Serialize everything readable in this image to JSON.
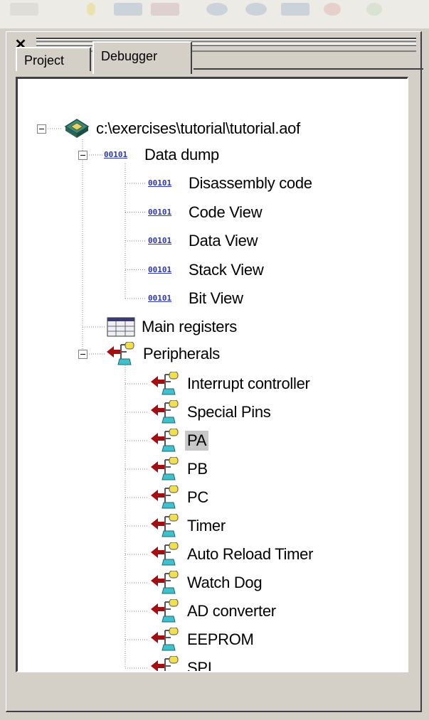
{
  "tabs": [
    {
      "label": "Project"
    },
    {
      "label": "Debugger"
    }
  ],
  "tree": {
    "root": {
      "label": "c:\\exercises\\tutorial\\tutorial.aof",
      "icon": "chip-icon"
    },
    "data_dump": {
      "label": "Data dump",
      "icon_text": "00101",
      "children": [
        {
          "label": "Disassembly code"
        },
        {
          "label": "Code View"
        },
        {
          "label": "Data View"
        },
        {
          "label": "Stack View"
        },
        {
          "label": "Bit View"
        }
      ]
    },
    "main_registers": {
      "label": "Main registers",
      "icon": "registers-icon"
    },
    "peripherals": {
      "label": "Peripherals",
      "icon": "peripheral-icon",
      "selected": "PA",
      "children": [
        {
          "label": "Interrupt controller"
        },
        {
          "label": "Special Pins"
        },
        {
          "label": "PA"
        },
        {
          "label": "PB"
        },
        {
          "label": "PC"
        },
        {
          "label": "Timer"
        },
        {
          "label": "Auto Reload Timer"
        },
        {
          "label": "Watch Dog"
        },
        {
          "label": "AD converter"
        },
        {
          "label": "EEPROM"
        },
        {
          "label": "SPI"
        }
      ]
    }
  },
  "colors": {
    "selection": "#c8c8c8",
    "code_icon": "#2b36a8",
    "panel_bg": "#d4d0c8"
  }
}
